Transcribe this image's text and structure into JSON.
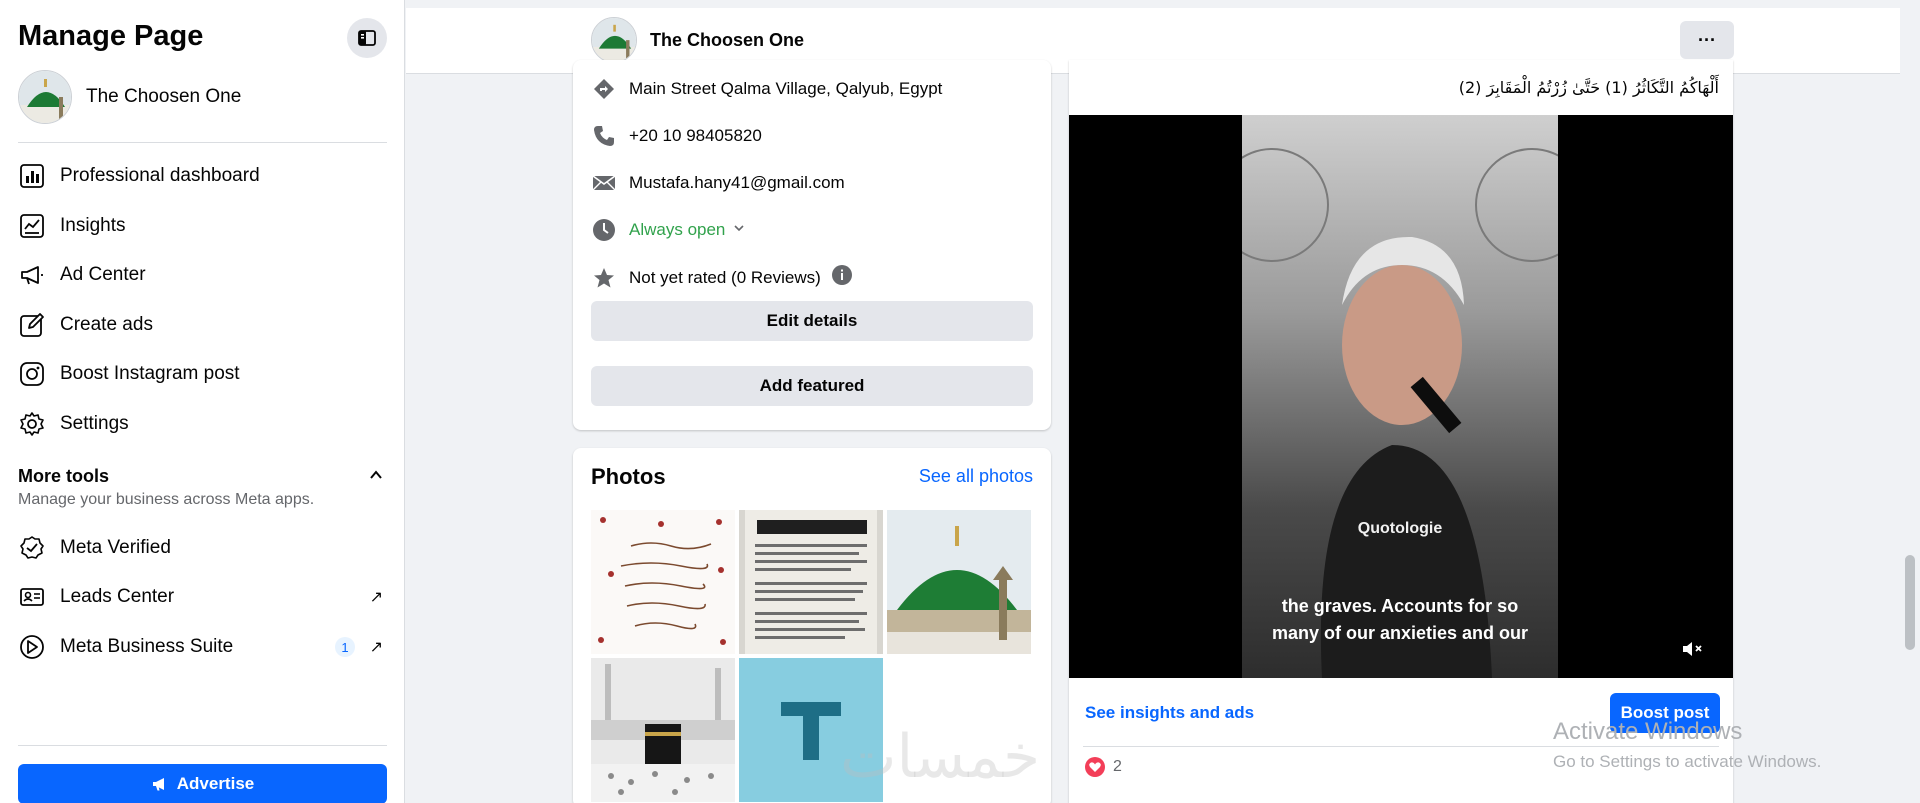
{
  "sidebar": {
    "title": "Manage Page",
    "page_name": "The Choosen One",
    "items": [
      {
        "label": "Professional dashboard",
        "icon": "dashboard-icon"
      },
      {
        "label": "Insights",
        "icon": "insights-icon"
      },
      {
        "label": "Ad Center",
        "icon": "megaphone-icon"
      },
      {
        "label": "Create ads",
        "icon": "pencil-icon"
      },
      {
        "label": "Boost Instagram post",
        "icon": "instagram-icon"
      },
      {
        "label": "Settings",
        "icon": "gear-icon"
      }
    ],
    "more_tools": {
      "title": "More tools",
      "subtitle": "Manage your business across Meta apps."
    },
    "tools": [
      {
        "label": "Meta Verified",
        "icon": "verified-badge-icon"
      },
      {
        "label": "Leads Center",
        "icon": "contact-card-icon"
      },
      {
        "label": "Meta Business Suite",
        "icon": "business-suite-icon",
        "badge": "1"
      }
    ],
    "advertise_label": "Advertise"
  },
  "header": {
    "page_name": "The Choosen One",
    "more_label": "···"
  },
  "intro": {
    "address": "Main Street Qalma Village, Qalyub, Egypt",
    "phone": "+20 10 98405820",
    "email": "Mustafa.hany41@gmail.com",
    "hours": "Always open",
    "rating": "Not yet rated (0 Reviews)",
    "edit_details_label": "Edit details",
    "add_featured_label": "Add featured"
  },
  "photos": {
    "title": "Photos",
    "see_all_label": "See all photos"
  },
  "post": {
    "text": "أَلْهَاكُمُ التَّكَاثُرُ (1) حَتَّىٰ زُرْتُمُ الْمَقَابِرَ (2)",
    "video_watermark": "Quotologie",
    "caption_line1": "the graves. Accounts for so",
    "caption_line2": "many of our anxieties and our",
    "see_insights_label": "See insights and ads",
    "boost_label": "Boost post",
    "reaction_count": "2"
  },
  "overlays": {
    "activate_title": "Activate Windows",
    "activate_sub": "Go to Settings to activate Windows.",
    "logo_text": "خمسات"
  },
  "colors": {
    "accent": "#0866ff",
    "green_status": "#31a24c",
    "background": "#f0f2f5"
  }
}
